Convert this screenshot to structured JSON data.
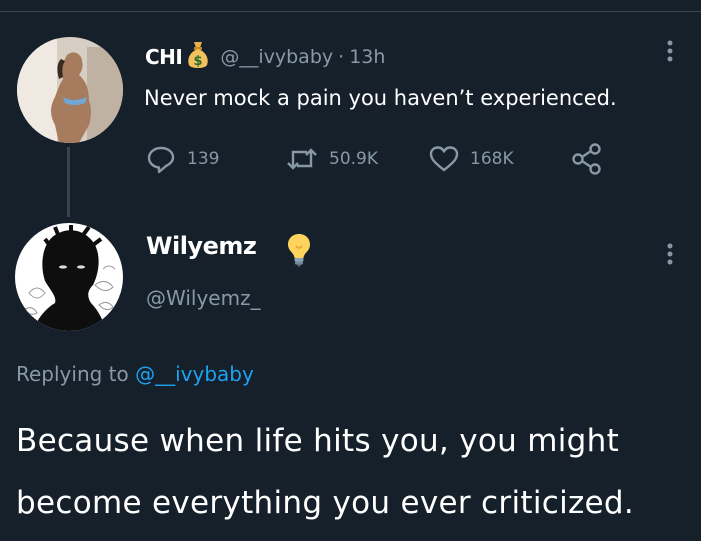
{
  "original_tweet": {
    "display_name": "CHI",
    "name_emoji": "money-bag-icon",
    "handle": "@__ivybaby",
    "separator": "·",
    "time": "13h",
    "text": "Never mock a pain you haven’t experienced.",
    "reply_count": "139",
    "retweet_count": "50.9K",
    "like_count": "168K"
  },
  "reply_tweet": {
    "display_name": "Wilyemz",
    "name_emoji": "light-bulb-icon",
    "handle": "@Wilyemz_",
    "replying_to_prefix": "Replying to",
    "replying_to_handle": "@__ivybaby",
    "text": "Because when life hits you, you might become everything you ever criticized."
  },
  "colors": {
    "background": "#15202b",
    "text_primary": "#ffffff",
    "text_secondary": "#8899a6",
    "link": "#1da1f2",
    "divider": "#38444d"
  }
}
